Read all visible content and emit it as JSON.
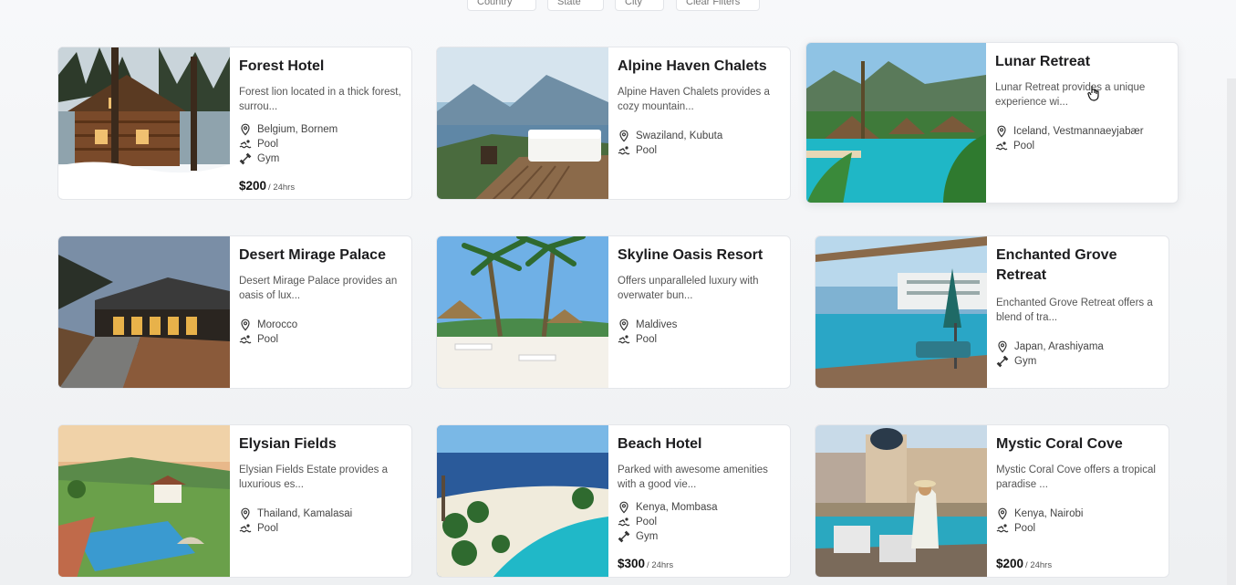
{
  "filters": {
    "country": "Country",
    "state": "State",
    "city": "City",
    "clear": "Clear Filters"
  },
  "hotels": [
    {
      "title": "Forest Hotel",
      "desc": "Forest lion located in a thick forest, surrou...",
      "location": "Belgium, Bornem",
      "amenities": [
        "Pool",
        "Gym"
      ],
      "price": "$200",
      "per": "/ 24hrs",
      "image": "snowy-log-cabin"
    },
    {
      "title": "Alpine Haven Chalets",
      "desc": "Alpine Haven Chalets provides a cozy mountain...",
      "location": "Swaziland, Kubuta",
      "amenities": [
        "Pool"
      ],
      "image": "mountain-deck-bed"
    },
    {
      "title": "Lunar Retreat",
      "desc": "Lunar Retreat provides a unique experience wi...",
      "location": "Iceland, Vestmannaeyjabær",
      "amenities": [
        "Pool"
      ],
      "image": "tropical-pool-huts"
    },
    {
      "title": "Desert Mirage Palace",
      "desc": "Desert Mirage Palace provides an oasis of lux...",
      "location": "Morocco",
      "amenities": [
        "Pool"
      ],
      "image": "lodge-at-dusk"
    },
    {
      "title": "Skyline Oasis Resort",
      "desc": "Offers unparalleled luxury with overwater bun...",
      "location": "Maldives",
      "amenities": [
        "Pool"
      ],
      "image": "palm-beach"
    },
    {
      "title": "Enchanted Grove Retreat",
      "desc": "Enchanted Grove Retreat offers a blend of tra...",
      "location": "Japan, Arashiyama",
      "amenities": [
        "Gym"
      ],
      "image": "infinity-pool-umbrella"
    },
    {
      "title": "Elysian Fields",
      "desc": "Elysian Fields Estate provides a luxurious es...",
      "location": "Thailand, Kamalasai",
      "amenities": [
        "Pool"
      ],
      "image": "hillside-pool"
    },
    {
      "title": "Beach Hotel",
      "desc": "Parked with awesome amenities with a good vie...",
      "location": "Kenya, Mombasa",
      "amenities": [
        "Pool",
        "Gym"
      ],
      "price": "$300",
      "per": "/ 24hrs",
      "image": "aerial-beach-resort"
    },
    {
      "title": "Mystic Coral Cove",
      "desc": "Mystic Coral Cove offers a tropical paradise ...",
      "location": "Kenya, Nairobi",
      "amenities": [
        "Pool"
      ],
      "price": "$200",
      "per": "/ 24hrs",
      "image": "rooftop-pool-city"
    }
  ],
  "icons": {
    "location": "map-pin-icon",
    "pool": "swimmer-icon",
    "gym": "dumbbell-icon"
  },
  "colors": {
    "card_bg": "#ffffff",
    "page_bg": "#f2f4f6",
    "title": "#1d1d1f",
    "text_muted": "#555555"
  }
}
